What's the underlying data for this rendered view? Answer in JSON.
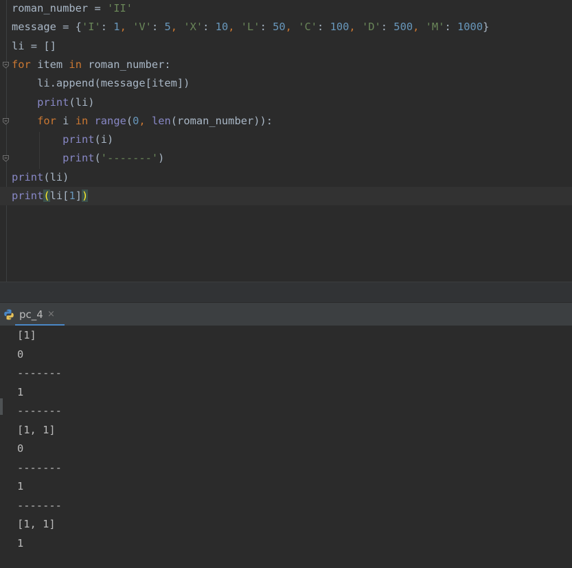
{
  "editor": {
    "lines": [
      [
        {
          "t": "roman_number = ",
          "c": "var"
        },
        {
          "t": "'II'",
          "c": "str"
        }
      ],
      [
        {
          "t": "message = {",
          "c": "var"
        },
        {
          "t": "'I'",
          "c": "str"
        },
        {
          "t": ": ",
          "c": "var"
        },
        {
          "t": "1",
          "c": "num"
        },
        {
          "t": ", ",
          "c": "kw"
        },
        {
          "t": "'V'",
          "c": "str"
        },
        {
          "t": ": ",
          "c": "var"
        },
        {
          "t": "5",
          "c": "num"
        },
        {
          "t": ", ",
          "c": "kw"
        },
        {
          "t": "'X'",
          "c": "str"
        },
        {
          "t": ": ",
          "c": "var"
        },
        {
          "t": "10",
          "c": "num"
        },
        {
          "t": ", ",
          "c": "kw"
        },
        {
          "t": "'L'",
          "c": "str"
        },
        {
          "t": ": ",
          "c": "var"
        },
        {
          "t": "50",
          "c": "num"
        },
        {
          "t": ", ",
          "c": "kw"
        },
        {
          "t": "'C'",
          "c": "str"
        },
        {
          "t": ": ",
          "c": "var"
        },
        {
          "t": "100",
          "c": "num"
        },
        {
          "t": ", ",
          "c": "kw"
        },
        {
          "t": "'D'",
          "c": "str"
        },
        {
          "t": ": ",
          "c": "var"
        },
        {
          "t": "500",
          "c": "num"
        },
        {
          "t": ", ",
          "c": "kw"
        },
        {
          "t": "'M'",
          "c": "str"
        },
        {
          "t": ": ",
          "c": "var"
        },
        {
          "t": "1000",
          "c": "num"
        },
        {
          "t": "}",
          "c": "var"
        }
      ],
      [
        {
          "t": "li = []",
          "c": "var"
        }
      ],
      [
        {
          "t": "for ",
          "c": "kw"
        },
        {
          "t": "item ",
          "c": "var"
        },
        {
          "t": "in ",
          "c": "kw"
        },
        {
          "t": "roman_number:",
          "c": "var"
        }
      ],
      [
        {
          "t": "    li.append(message[item])",
          "c": "var"
        }
      ],
      [
        {
          "t": "    ",
          "c": "var"
        },
        {
          "t": "print",
          "c": "call"
        },
        {
          "t": "(li)",
          "c": "var"
        }
      ],
      [
        {
          "t": "    ",
          "c": "var"
        },
        {
          "t": "for ",
          "c": "kw"
        },
        {
          "t": "i ",
          "c": "var"
        },
        {
          "t": "in ",
          "c": "kw"
        },
        {
          "t": "range",
          "c": "call"
        },
        {
          "t": "(",
          "c": "var"
        },
        {
          "t": "0",
          "c": "num"
        },
        {
          "t": ", ",
          "c": "kw"
        },
        {
          "t": "len",
          "c": "call"
        },
        {
          "t": "(roman_number)):",
          "c": "var"
        }
      ],
      [
        {
          "t": "        ",
          "c": "var"
        },
        {
          "t": "print",
          "c": "call"
        },
        {
          "t": "(i)",
          "c": "var"
        }
      ],
      [
        {
          "t": "        ",
          "c": "var"
        },
        {
          "t": "print",
          "c": "call"
        },
        {
          "t": "(",
          "c": "var"
        },
        {
          "t": "'-------'",
          "c": "str"
        },
        {
          "t": ")",
          "c": "var"
        }
      ],
      [
        {
          "t": "print",
          "c": "call"
        },
        {
          "t": "(li)",
          "c": "var"
        }
      ],
      [
        {
          "t": "print",
          "c": "call"
        },
        {
          "t": "(",
          "c": "brk"
        },
        {
          "t": "li[",
          "c": "var"
        },
        {
          "t": "1",
          "c": "num"
        },
        {
          "t": "]",
          "c": "var"
        },
        {
          "t": ")",
          "c": "brk"
        }
      ]
    ],
    "current_line": 10,
    "fold_markers": [
      3,
      6,
      8
    ]
  },
  "run_tab": {
    "label": "pc_4",
    "close_glyph": "×",
    "icon": "python-icon"
  },
  "console": {
    "lines": [
      "[1]",
      "0",
      "-------",
      "1",
      "-------",
      "[1, 1]",
      "0",
      "-------",
      "1",
      "-------",
      "[1, 1]",
      "1"
    ]
  }
}
